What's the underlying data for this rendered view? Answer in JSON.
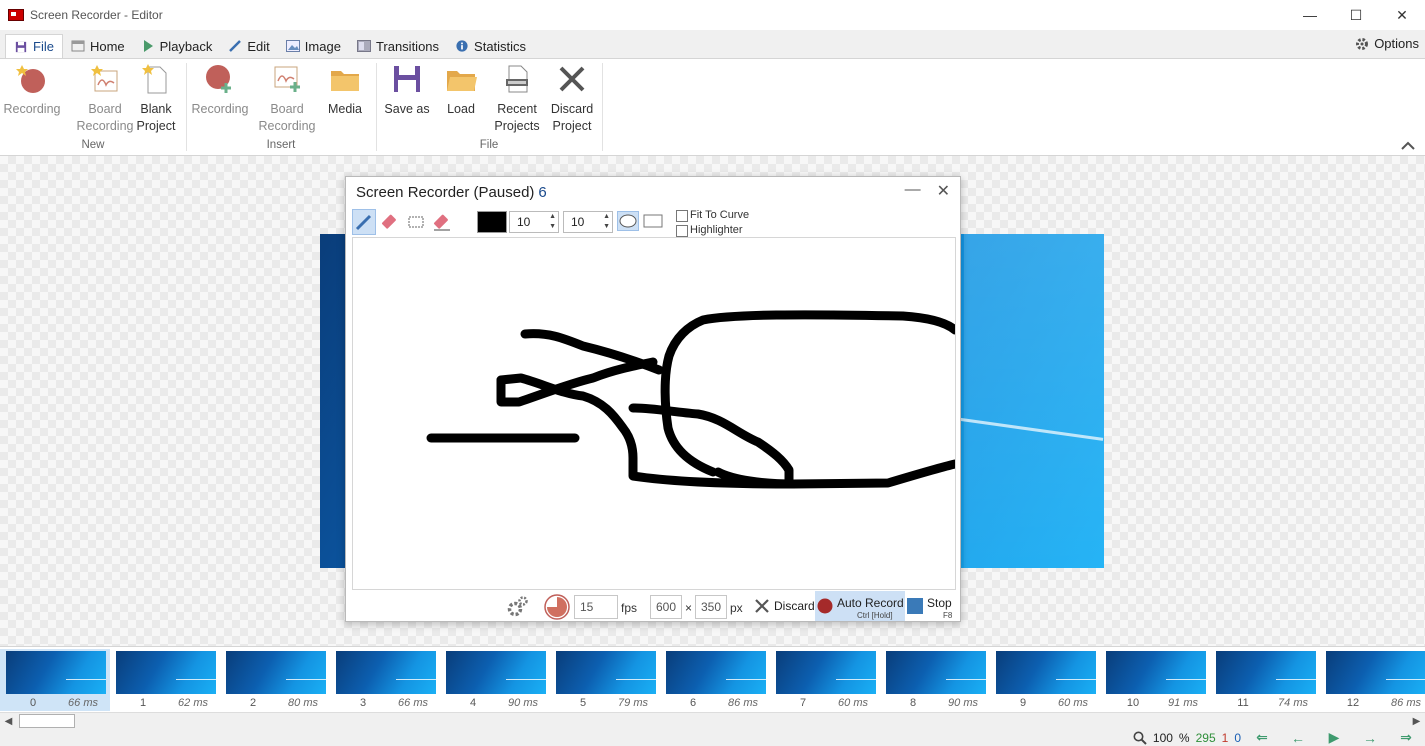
{
  "window": {
    "title": "Screen Recorder - Editor",
    "minimize": "—",
    "maximize": "☐",
    "close": "✕"
  },
  "tabs": [
    {
      "label": "File",
      "icon": "save-icon",
      "active": true
    },
    {
      "label": "Home",
      "icon": "home-icon"
    },
    {
      "label": "Playback",
      "icon": "play-icon"
    },
    {
      "label": "Edit",
      "icon": "pencil-icon"
    },
    {
      "label": "Image",
      "icon": "image-icon"
    },
    {
      "label": "Transitions",
      "icon": "transitions-icon"
    },
    {
      "label": "Statistics",
      "icon": "info-icon"
    }
  ],
  "options_label": "Options",
  "ribbon": {
    "new": {
      "label": "New",
      "recording": "Recording",
      "board_recording_1": "Board",
      "board_recording_2": "Recording",
      "blank_project_1": "Blank",
      "blank_project_2": "Project"
    },
    "insert": {
      "label": "Insert",
      "recording": "Recording",
      "board_recording_1": "Board",
      "board_recording_2": "Recording",
      "media": "Media"
    },
    "file": {
      "label": "File",
      "save_as": "Save as",
      "load": "Load",
      "recent_projects_1": "Recent",
      "recent_projects_2": "Projects",
      "discard_project_1": "Discard",
      "discard_project_2": "Project"
    }
  },
  "recorder": {
    "title": "Screen Recorder (Paused)",
    "frame_count": "6",
    "minimize": "—",
    "close": "✕",
    "pen_width": "10",
    "pen_height": "10",
    "fit_to_curve": "Fit To Curve",
    "highlighter": "Highlighter",
    "fps_value": "15",
    "fps_label": "fps",
    "width": "600",
    "times": "×",
    "height": "350",
    "px_label": "px",
    "discard": "Discard",
    "auto_record": "Auto Record",
    "auto_record_shortcut": "Ctrl [Hold]",
    "stop": "Stop",
    "stop_shortcut": "F8"
  },
  "frames": [
    {
      "number": "0",
      "delay": "66 ms"
    },
    {
      "number": "1",
      "delay": "62 ms"
    },
    {
      "number": "2",
      "delay": "80 ms"
    },
    {
      "number": "3",
      "delay": "66 ms"
    },
    {
      "number": "4",
      "delay": "90 ms"
    },
    {
      "number": "5",
      "delay": "79 ms"
    },
    {
      "number": "6",
      "delay": "86 ms"
    },
    {
      "number": "7",
      "delay": "60 ms"
    },
    {
      "number": "8",
      "delay": "90 ms"
    },
    {
      "number": "9",
      "delay": "60 ms"
    },
    {
      "number": "10",
      "delay": "91 ms"
    },
    {
      "number": "11",
      "delay": "74 ms"
    },
    {
      "number": "12",
      "delay": "86 ms"
    }
  ],
  "status": {
    "zoom": "100",
    "zoom_unit": "%",
    "total_frames": "295",
    "selected_frames": "1",
    "current_frame": "0"
  },
  "colors": {
    "accent": "#1a4a8c",
    "brand_red": "#cc0000",
    "total_green": "#2f8f3a",
    "selected_red": "#c0392b",
    "current_blue": "#1a5fb4",
    "pen_color": "#000000"
  }
}
